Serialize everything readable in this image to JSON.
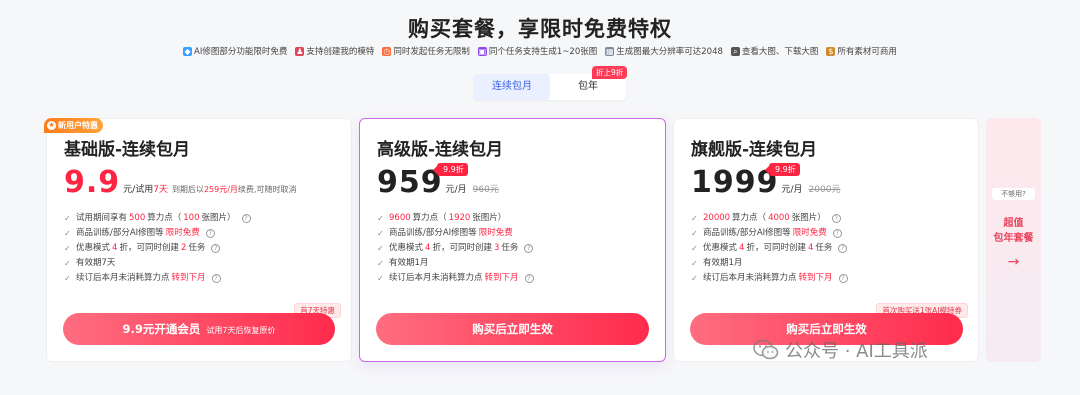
{
  "header": {
    "title": "购买套餐，享限时免费特权"
  },
  "perks": [
    {
      "icon": "diamond-icon",
      "color": "#3aa0ff",
      "label": "AI修图部分功能限时免费"
    },
    {
      "icon": "model-icon",
      "color": "#e0455a",
      "label": "支持创建我的模特"
    },
    {
      "icon": "clock-icon",
      "color": "#ff6a3a",
      "label": "同时发起任务无限制"
    },
    {
      "icon": "image-count-icon",
      "color": "#8a4be6",
      "label": "同个任务支持生成1~20张图"
    },
    {
      "icon": "resolution-icon",
      "color": "#7a8aa0",
      "label": "生成图最大分辨率可达2048"
    },
    {
      "icon": "zoom-icon",
      "color": "#555555",
      "label": "查看大图、下载大图"
    },
    {
      "icon": "commercial-icon",
      "color": "#d08a2a",
      "label": "所有素材可商用"
    }
  ],
  "billing_toggle": {
    "monthly_label": "连续包月",
    "yearly_label": "包年",
    "yearly_badge": "折上9折",
    "selected": "monthly"
  },
  "plans": [
    {
      "badge": "新用户特惠",
      "name": "基础版-连续包月",
      "price": "9.9",
      "unit": "元/试用",
      "trial_days": "7天",
      "note_prefix": "到期后以",
      "note_price": "259元/月",
      "note_suffix": "续费,可随时取消",
      "features": [
        {
          "pre": "试用期间享有",
          "hl": "500",
          "post": "算力点（",
          "hl2": "100",
          "post2": "张图片）",
          "help": true
        },
        {
          "pre": "商品训练/部分AI修图等",
          "hl": "限时免费",
          "post": "",
          "help": true
        },
        {
          "pre": "优惠模式",
          "hl": "4",
          "post": "折，可同时创建",
          "hl2": "2",
          "post2": "任务",
          "help": true
        },
        {
          "pre": "有效期7天",
          "hl": "",
          "post": "",
          "help": false
        },
        {
          "pre": "续订后本月未消耗算力点",
          "hl": "转到下月",
          "post": "",
          "help": true
        }
      ],
      "cta": "9.9元开通会员",
      "cta_sub": "试用7天后恢复原价",
      "corner_tag": "首7天特惠"
    },
    {
      "name": "高级版-连续包月",
      "price": "959",
      "unit": "元/月",
      "original_price": "960元",
      "discount_tag": "9.9折",
      "features": [
        {
          "pre": "",
          "hl": "9600",
          "post": "算力点（",
          "hl2": "1920",
          "post2": "张图片）",
          "help": false
        },
        {
          "pre": "商品训练/部分AI修图等",
          "hl": "限时免费",
          "post": "",
          "help": false
        },
        {
          "pre": "优惠模式",
          "hl": "4",
          "post": "折，可同时创建",
          "hl2": "3",
          "post2": "任务",
          "help": true
        },
        {
          "pre": "有效期1月",
          "hl": "",
          "post": "",
          "help": false
        },
        {
          "pre": "续订后本月未消耗算力点",
          "hl": "转到下月",
          "post": "",
          "help": true
        }
      ],
      "cta": "购买后立即生效"
    },
    {
      "name": "旗舰版-连续包月",
      "price": "1999",
      "unit": "元/月",
      "original_price": "2000元",
      "discount_tag": "9.9折",
      "features": [
        {
          "pre": "",
          "hl": "20000",
          "post": "算力点（",
          "hl2": "4000",
          "post2": "张图片）",
          "help": true
        },
        {
          "pre": "商品训练/部分AI修图等",
          "hl": "限时免费",
          "post": "",
          "help": true
        },
        {
          "pre": "优惠模式",
          "hl": "4",
          "post": "折，可同时创建",
          "hl2": "4",
          "post2": "任务",
          "help": true
        },
        {
          "pre": "有效期1月",
          "hl": "",
          "post": "",
          "help": false
        },
        {
          "pre": "续订后本月未消耗算力点",
          "hl": "转到下月",
          "post": "",
          "help": true
        }
      ],
      "cta": "购买后立即生效",
      "corner_tag": "首次购买送1张AI模特券"
    }
  ],
  "side_card": {
    "question": "不够用?",
    "line1": "超值",
    "line2": "包年套餐",
    "arrow": "→"
  },
  "watermark": "公众号 · AI工具派",
  "colors": {
    "accent_red": "#ff2442",
    "toggle_blue": "#3a63e0",
    "featured_border": "#c66be0"
  }
}
